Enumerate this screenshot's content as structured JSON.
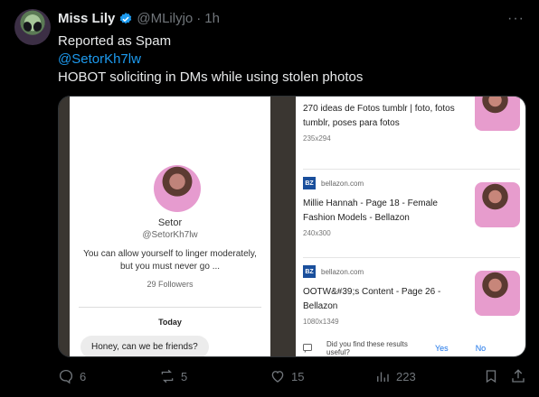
{
  "tweet": {
    "author_name": "Miss Lily",
    "handle": "@MLilyjo",
    "dot": "·",
    "time": "1h",
    "line1": "Reported as Spam",
    "mention": "@SetorKh7lw",
    "line3": "HOBOT soliciting in DMs while using stolen photos"
  },
  "screenshot_left": {
    "profile_name": "Setor",
    "profile_handle": "@SetorKh7lw",
    "bio": "You can allow yourself to linger moderately, but you must never go ...",
    "followers": "29 Followers",
    "day_label": "Today",
    "message": "Honey, can we be friends?"
  },
  "screenshot_right": {
    "results": [
      {
        "title": "270 ideas de Fotos tumblr | foto, fotos tumblr, poses para fotos",
        "size": "235x294"
      },
      {
        "source": "bellazon.com",
        "favicon": "BZ",
        "title": "Millie Hannah - Page 18 - Female Fashion Models - Bellazon",
        "size": "240x300"
      },
      {
        "source": "bellazon.com",
        "favicon": "BZ",
        "title": "OOTW&#39;s Content - Page 26 - Bellazon",
        "size": "1080x1349"
      }
    ],
    "feedback_text": "Did you find these results useful?",
    "feedback_yes": "Yes",
    "feedback_no": "No"
  },
  "actions": {
    "replies": "6",
    "reposts": "5",
    "likes": "15",
    "views": "223"
  },
  "icons": [
    "verified-icon",
    "more-icon",
    "reply-icon",
    "repost-icon",
    "like-icon",
    "views-icon",
    "bookmark-icon",
    "share-icon",
    "feedback-icon"
  ],
  "colors": {
    "accent": "#1d9bf0",
    "muted": "#71767b",
    "background": "#000000"
  }
}
